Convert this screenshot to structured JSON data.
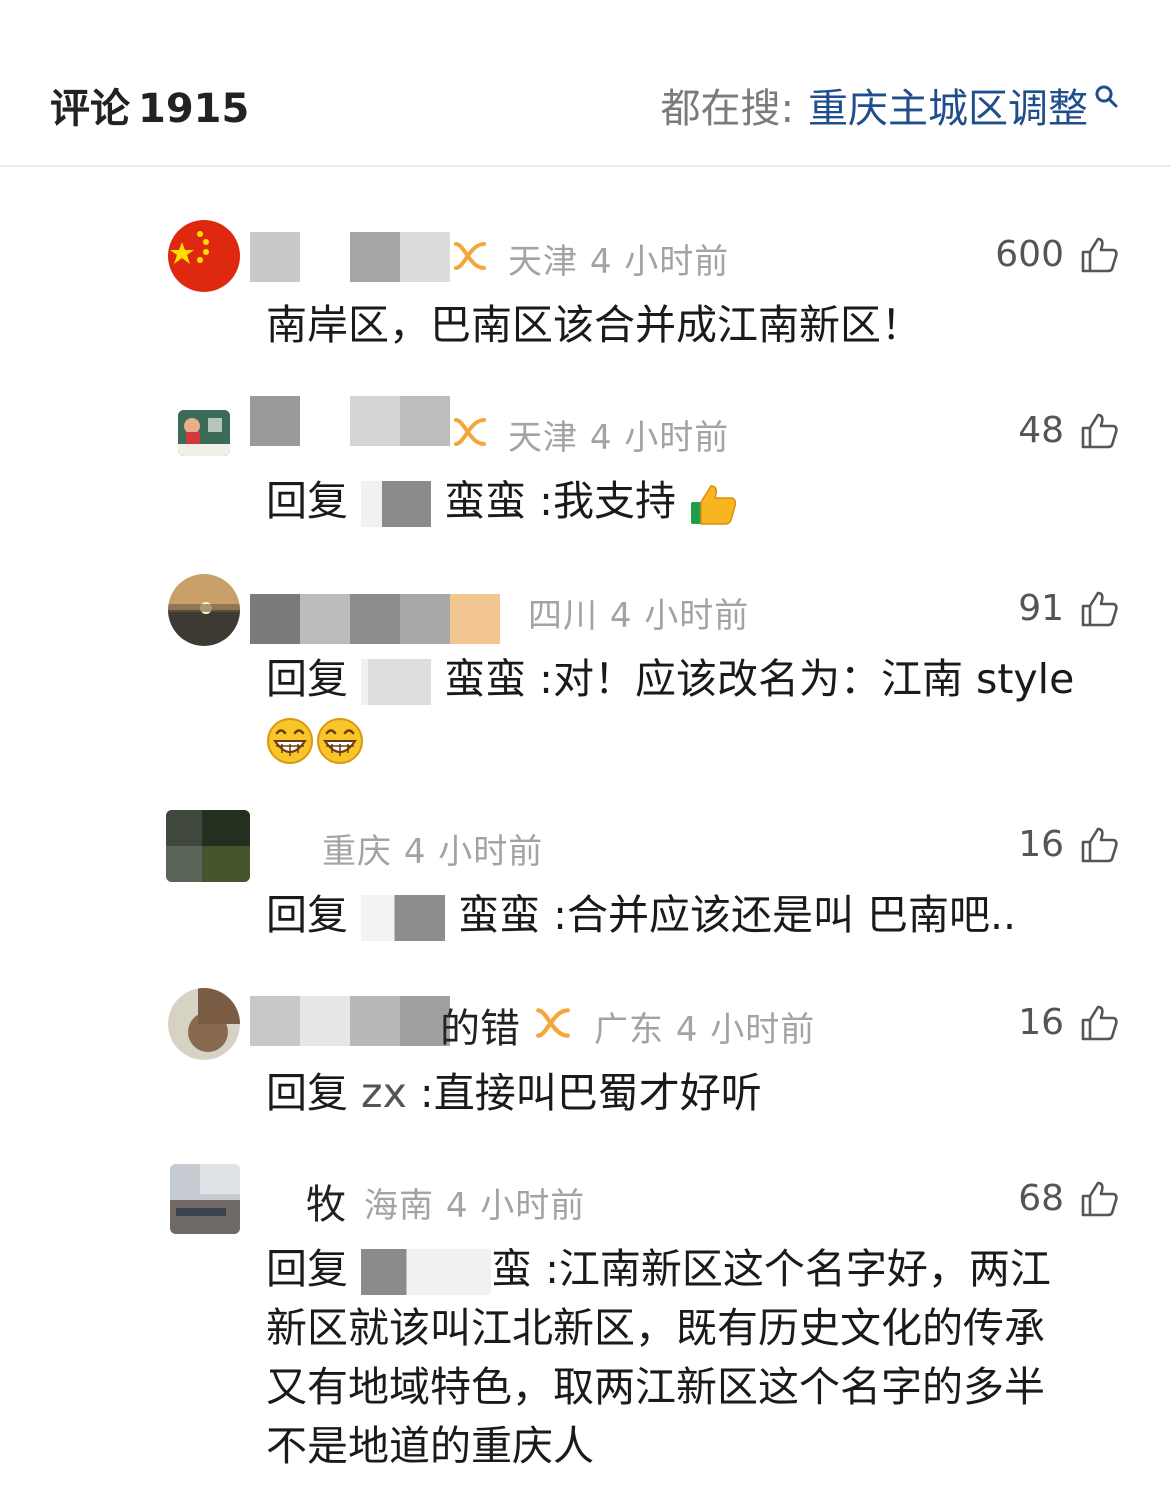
{
  "header": {
    "title": "评论",
    "count": "1915",
    "trend_label": "都在搜:",
    "trend_topic": "重庆主城区调整",
    "trend_icon": "search-icon"
  },
  "colors": {
    "topic_link": "#1f4e8c",
    "meta_text": "#a3a3a3",
    "vip_badge": "#f5a63a"
  },
  "comments": [
    {
      "user_suffix": "",
      "location": "天津",
      "time": "4 小时前",
      "likes": "600",
      "text": "南岸区，巴南区该合并成江南新区！"
    },
    {
      "user_suffix": "",
      "location": "天津",
      "time": "4 小时前",
      "likes": "48",
      "reply_prefix": "回复",
      "reply_to": "蛮蛮",
      "text": ":我支持",
      "emoji": "thumbs-up-emoji"
    },
    {
      "user_suffix": "",
      "location": "四川",
      "time": "4 小时前",
      "likes": "91",
      "reply_prefix": "回复",
      "reply_to": "蛮蛮",
      "text": ":对！应该改名为：江南 style",
      "emoji": "grin-emoji"
    },
    {
      "user_suffix": "",
      "location": "重庆",
      "time": "4 小时前",
      "likes": "16",
      "reply_prefix": "回复",
      "reply_to": "蛮蛮",
      "text": ":合并应该还是叫 巴南吧.."
    },
    {
      "user_suffix": "的错",
      "location": "广东",
      "time": "4 小时前",
      "likes": "16",
      "reply_prefix": "回复",
      "reply_to": "zx",
      "text": ":直接叫巴蜀才好听"
    },
    {
      "user_suffix": "牧",
      "location": "海南",
      "time": "4 小时前",
      "likes": "68",
      "reply_prefix": "回复",
      "reply_to": "蛮",
      "text_lines": [
        ":江南新区这个名字好，两江",
        "新区就该叫江北新区，既有历史文化的传承",
        "又有地域特色，取两江新区这个名字的多半",
        "不是地道的重庆人"
      ]
    }
  ]
}
